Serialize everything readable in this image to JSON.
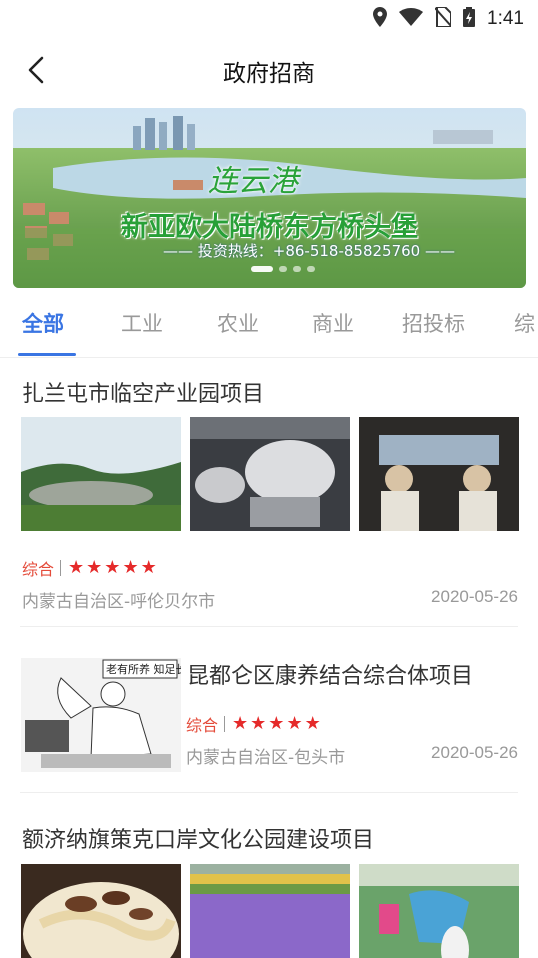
{
  "status": {
    "time": "1:41"
  },
  "header": {
    "title": "政府招商"
  },
  "banner": {
    "logo_text": "连云港",
    "headline": "新亚欧大陆桥东方桥头堡",
    "hotline": "—— 投资热线：+86-518-85825760 ——"
  },
  "tabs": [
    {
      "label": "全部",
      "active": true
    },
    {
      "label": "工业"
    },
    {
      "label": "农业"
    },
    {
      "label": "商业"
    },
    {
      "label": "招投标"
    },
    {
      "label": "综"
    }
  ],
  "projects": [
    {
      "title": "扎兰屯市临空产业园项目",
      "type": "综合",
      "rating": 5,
      "region": "内蒙古自治区-呼伦贝尔市",
      "date": "2020-05-26",
      "images": [
        "helipad-landscape",
        "flight-simulator",
        "cockpit"
      ]
    },
    {
      "title": "昆都仑区康养结合综合体项目",
      "type": "综合",
      "rating": 5,
      "region": "内蒙古自治区-包头市",
      "date": "2020-05-26",
      "images": [
        "cartoon-elder"
      ],
      "cartoon_caption": "老有所养 知足长乐"
    },
    {
      "title": "额济纳旗策克口岸文化公园建设项目",
      "images": [
        "noodle-dish",
        "flower-field",
        "water-park"
      ]
    }
  ],
  "colors": {
    "accent": "#3a75e3",
    "star": "#e52a2a",
    "type_label": "#e44b3a"
  }
}
